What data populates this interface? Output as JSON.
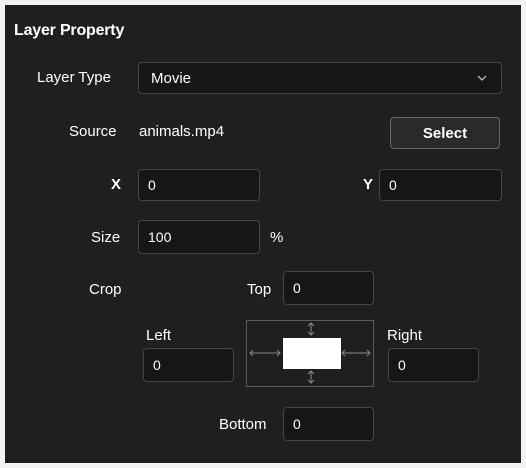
{
  "panel": {
    "title": "Layer Property"
  },
  "layer_type": {
    "label": "Layer Type",
    "value": "Movie",
    "icon": "chevron-down-icon"
  },
  "source": {
    "label": "Source",
    "filename": "animals.mp4",
    "button_label": "Select"
  },
  "position": {
    "x_label": "X",
    "x_value": "0",
    "y_label": "Y",
    "y_value": "0"
  },
  "size": {
    "label": "Size",
    "value": "100",
    "unit": "%"
  },
  "crop": {
    "label": "Crop",
    "top_label": "Top",
    "top_value": "0",
    "left_label": "Left",
    "left_value": "0",
    "right_label": "Right",
    "right_value": "0",
    "bottom_label": "Bottom",
    "bottom_value": "0"
  },
  "colors": {
    "panel_bg": "#1f1f1f",
    "field_bg": "#161616",
    "border": "#454545",
    "text": "#ffffff"
  }
}
